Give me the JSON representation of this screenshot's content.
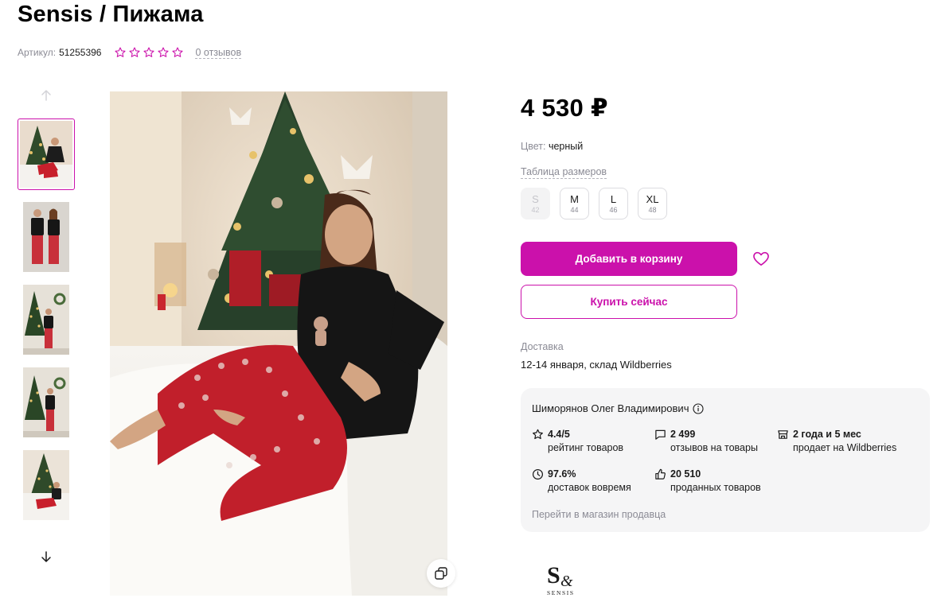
{
  "product": {
    "title": "Sensis / Пижама",
    "article_label": "Артикул:",
    "article_value": "51255396",
    "rating_stars": 0,
    "reviews_link": "0 отзывов"
  },
  "gallery": {
    "thumbnails": [
      {
        "name": "Фото 1",
        "active": true
      },
      {
        "name": "Фото 2",
        "active": false
      },
      {
        "name": "Фото 3",
        "active": false
      },
      {
        "name": "Фото 4",
        "active": false
      },
      {
        "name": "Фото 5",
        "active": false
      }
    ]
  },
  "buy": {
    "price": "4 530 ₽",
    "color_label": "Цвет:",
    "color_value": "черный",
    "size_table_link": "Таблица размеров",
    "sizes": [
      {
        "label": "S",
        "num": "42",
        "available": false
      },
      {
        "label": "M",
        "num": "44",
        "available": true
      },
      {
        "label": "L",
        "num": "46",
        "available": true
      },
      {
        "label": "XL",
        "num": "48",
        "available": true
      }
    ],
    "add_to_cart": "Добавить в корзину",
    "buy_now": "Купить сейчас",
    "delivery_label": "Доставка",
    "delivery_value": "12-14 января, склад Wildberries"
  },
  "seller": {
    "name": "Шиморянов Олег Владимирович",
    "stats": [
      {
        "icon": "star-icon",
        "value": "4.4/5",
        "desc": "рейтинг товаров"
      },
      {
        "icon": "comment-icon",
        "value": "2 499",
        "desc": "отзывов на товары"
      },
      {
        "icon": "shop-icon",
        "value": "2 года и 5 мес",
        "desc": "продает на Wildberries"
      },
      {
        "icon": "clock-icon",
        "value": "97.6%",
        "desc": "доставок вовремя"
      },
      {
        "icon": "thumbs-up-icon",
        "value": "20 510",
        "desc": "проданных товаров"
      }
    ],
    "store_link": "Перейти в магазин продавца"
  },
  "brand": {
    "logo_text": "SENSIS"
  },
  "colors": {
    "accent": "#cb11ab",
    "muted": "#8b8b95",
    "card_bg": "#f5f5f6"
  }
}
